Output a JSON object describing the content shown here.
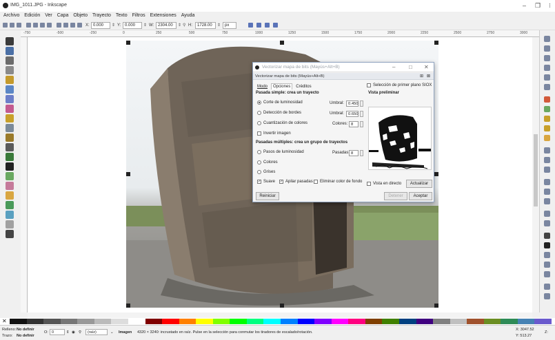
{
  "window": {
    "title": "IMG_1011.JPG - Inkscape",
    "controls": {
      "minimize": "–",
      "maximize": "❐",
      "close": "⁝"
    }
  },
  "menu": [
    "Archivo",
    "Edición",
    "Ver",
    "Capa",
    "Objeto",
    "Trayecto",
    "Texto",
    "Filtros",
    "Extensiones",
    "Ayuda"
  ],
  "controls_bar": {
    "x_label": "X:",
    "x_value": "0.000",
    "y_label": "Y:",
    "y_value": "0.000",
    "w_label": "W:",
    "w_value": "2304.00",
    "h_label": "H:",
    "h_value": "1728.00",
    "unit": "px"
  },
  "ruler": {
    "labels": [
      "-750",
      "-500",
      "-250",
      "0",
      "250",
      "500",
      "750",
      "1000",
      "1250",
      "1500",
      "1750",
      "2000",
      "2250",
      "2500",
      "2750",
      "3000"
    ]
  },
  "dialog": {
    "title": "Vectorizar mapa de bits (Mayús+Alt+B)",
    "subtitle": "Vectorizar mapa de bits (Mayús+Alt+B)",
    "tabs": [
      "Modo",
      "Opciones",
      "Créditos"
    ],
    "single_scan_header": "Pasada simple: crea un trayecto",
    "single_options": [
      {
        "label": "Corte de luminosidad",
        "selected": true,
        "param_label": "Umbral:",
        "param_value": "0.450"
      },
      {
        "label": "Detección de bordes",
        "selected": false,
        "param_label": "Umbral:",
        "param_value": "0.650"
      },
      {
        "label": "Cuantización de colores",
        "selected": false,
        "param_label": "Colores:",
        "param_value": "8"
      }
    ],
    "invert_label": "Invertir imagen",
    "multi_scan_header": "Pasadas múltiples: crea un grupo de trayectos",
    "multi_options": [
      {
        "label": "Pasos de luminosidad",
        "param_label": "Pasadas:",
        "param_value": "8"
      },
      {
        "label": "Colores"
      },
      {
        "label": "Grises"
      }
    ],
    "smooth_label": "Suave",
    "stack_label": "Apilar pasadas",
    "remove_bg_label": "Eliminar color de fondo",
    "siox_label": "Selección de primer plano SIOX",
    "preview_label": "Vista preliminar",
    "live_preview_label": "Vista en directo",
    "update_button": "Actualizar",
    "reset_button": "Reiniciar",
    "stop_button": "Detener",
    "ok_button": "Aceptar"
  },
  "status": {
    "fill_label": "Relleno:",
    "fill_value": "No definir",
    "stroke_label": "Trazo:",
    "stroke_value": "No definir",
    "opacity_label": "O:",
    "opacity_value": "0",
    "layer": "(raíz)",
    "message_bold": "Imagen",
    "message": "4320 × 3240: incrustado en raíz. Pulse en la selección para conmutar los tiradores de escalado/rotación.",
    "coord_x": "X: 3047.52",
    "coord_y": "Y: 513.27",
    "zoom_label": "Z:"
  },
  "palette_colors": [
    "#111111",
    "#333333",
    "#555555",
    "#777777",
    "#999999",
    "#bbbbbb",
    "#dddddd",
    "#ffffff",
    "#800000",
    "#ff0000",
    "#ff8000",
    "#ffff00",
    "#80ff00",
    "#00ff00",
    "#00ff80",
    "#00ffff",
    "#0080ff",
    "#0000ff",
    "#8000ff",
    "#ff00ff",
    "#ff0080",
    "#804000",
    "#408000",
    "#004080",
    "#400080",
    "#808080",
    "#c0c0c0",
    "#a0522d",
    "#6b8e23",
    "#2e8b57",
    "#4682b4",
    "#6a5acd"
  ]
}
